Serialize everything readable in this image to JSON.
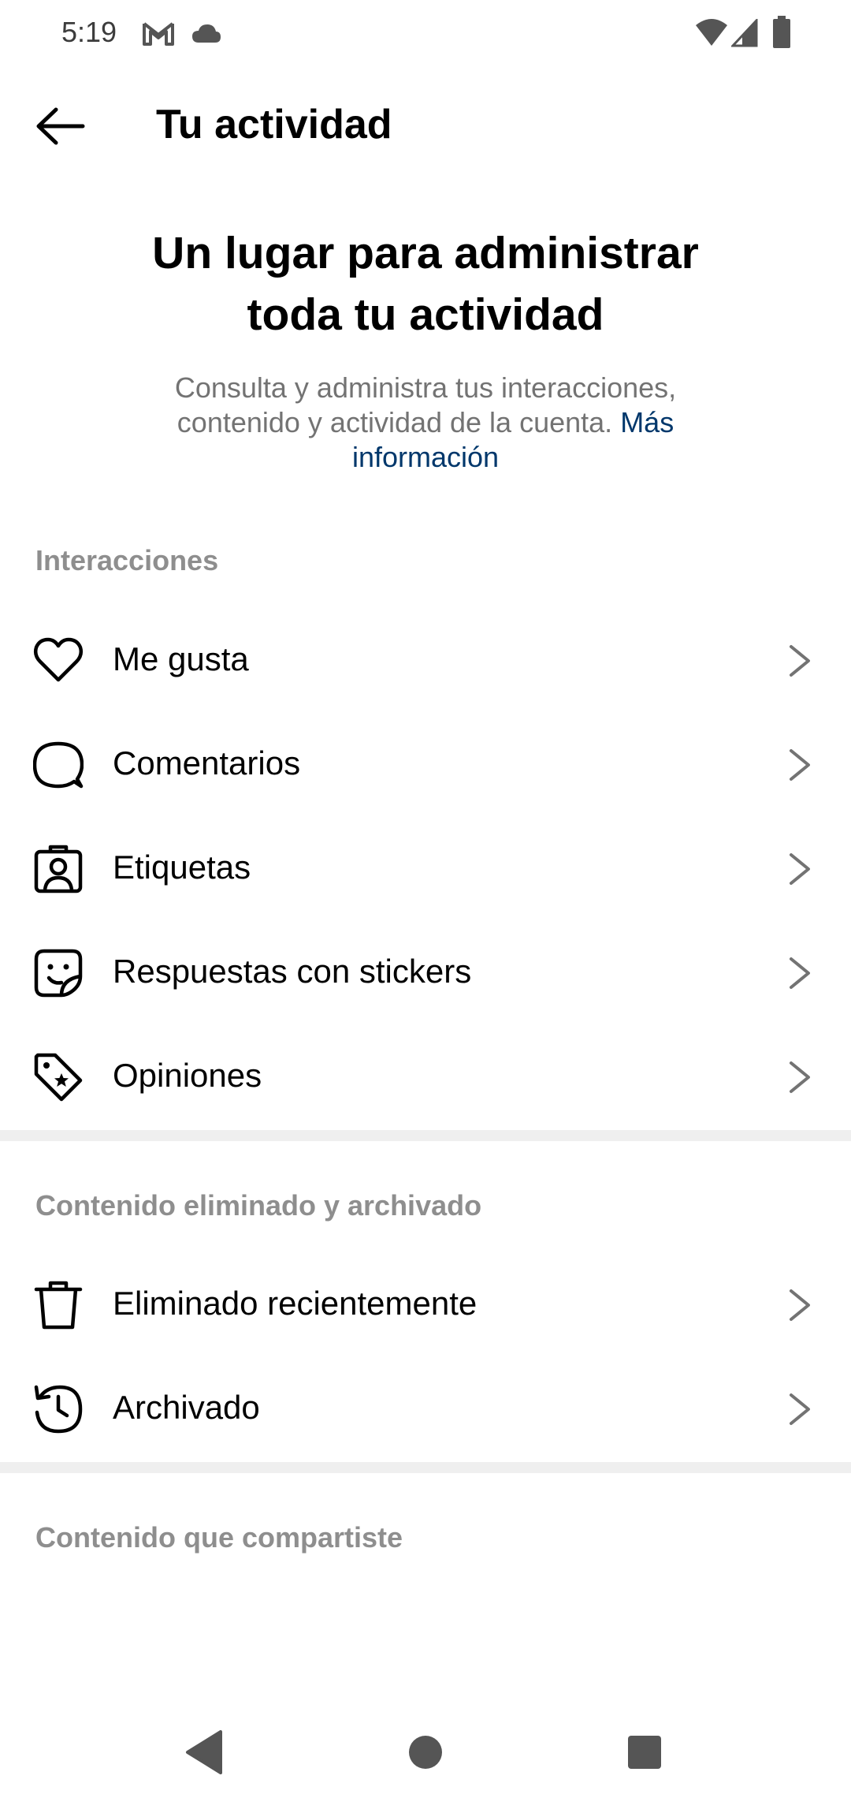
{
  "status_bar": {
    "time": "5:19",
    "icons_left": [
      "gmail-icon",
      "cloud-icon"
    ],
    "icons_right": [
      "wifi-icon",
      "cell-signal-icon",
      "battery-icon"
    ]
  },
  "app_bar": {
    "back_icon": "arrow-left-icon",
    "title": "Tu actividad"
  },
  "hero": {
    "title_line1": "Un lugar para administrar",
    "title_line2": "toda tu actividad",
    "description": "Consulta y administra tus interacciones, contenido y actividad de la cuenta.",
    "link": "Más información"
  },
  "sections": [
    {
      "header": "Interacciones",
      "items": [
        {
          "label": "Me gusta",
          "icon": "heart-icon"
        },
        {
          "label": "Comentarios",
          "icon": "comment-icon"
        },
        {
          "label": "Etiquetas",
          "icon": "tag-person-icon"
        },
        {
          "label": "Respuestas con stickers",
          "icon": "sticker-icon"
        },
        {
          "label": "Opiniones",
          "icon": "review-tag-icon"
        }
      ]
    },
    {
      "header": "Contenido eliminado y archivado",
      "items": [
        {
          "label": "Eliminado recientemente",
          "icon": "trash-icon"
        },
        {
          "label": "Archivado",
          "icon": "archive-history-icon"
        }
      ]
    },
    {
      "header": "Contenido que compartiste",
      "items": []
    }
  ],
  "nav_bar": {
    "buttons": [
      "back-triangle-icon",
      "home-circle-icon",
      "recents-square-icon"
    ]
  },
  "colors": {
    "link": "#00376b",
    "muted_text": "#737373",
    "section_header": "#8e8e8e",
    "divider": "#efefef"
  }
}
